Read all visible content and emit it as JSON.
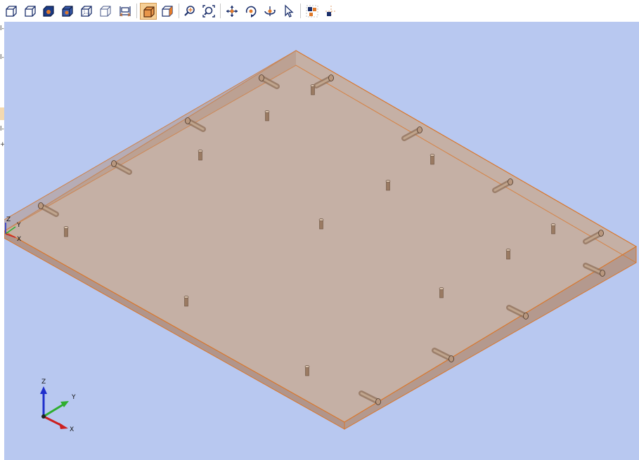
{
  "toolbar": {
    "buttons": [
      {
        "name": "view-wireframe-button",
        "icon": "wire-cube-icon"
      },
      {
        "name": "view-hidden-line-button",
        "icon": "hidden-line-cube-icon"
      },
      {
        "name": "view-shaded-button",
        "icon": "shaded-cube-icon"
      },
      {
        "name": "view-shaded-edges-button",
        "icon": "shaded-edges-cube-icon"
      },
      {
        "name": "view-hidden-button",
        "icon": "hidden-cube-icon"
      },
      {
        "name": "view-outline-button",
        "icon": "outline-cube-icon"
      },
      {
        "name": "view-dimensions-button",
        "icon": "dimension-icon"
      },
      {
        "name": "view-transparent-button",
        "icon": "transparent-cube-icon",
        "active": true
      },
      {
        "name": "view-perspective-button",
        "icon": "perspective-cube-icon"
      },
      {
        "name": "zoom-button",
        "icon": "zoom-icon"
      },
      {
        "name": "zoom-fit-button",
        "icon": "zoom-fit-icon"
      },
      {
        "name": "pan-button",
        "icon": "pan-icon"
      },
      {
        "name": "rotate-button",
        "icon": "rotate-icon"
      },
      {
        "name": "rotate-axis-button",
        "icon": "rotate-axis-icon"
      },
      {
        "name": "select-button",
        "icon": "cursor-icon"
      },
      {
        "name": "snap-grid-button",
        "icon": "snap-grid-icon"
      },
      {
        "name": "snap-origin-button",
        "icon": "snap-origin-icon"
      }
    ]
  },
  "left_panel_stubs": [
    "l-",
    "l-",
    "",
    "l-",
    "+"
  ],
  "viewport": {
    "background": "#b8c8f0",
    "model_fill": "#c9a790",
    "model_edge": "#e07a2b",
    "axis_colors": {
      "x": "#cc1f1f",
      "y": "#2fae2f",
      "z": "#1f2fcc"
    }
  },
  "mini_axes": {
    "z": "Z",
    "y": "Y",
    "x": "X"
  },
  "triad": {
    "z": "Z",
    "y": "Y",
    "x": "X"
  }
}
